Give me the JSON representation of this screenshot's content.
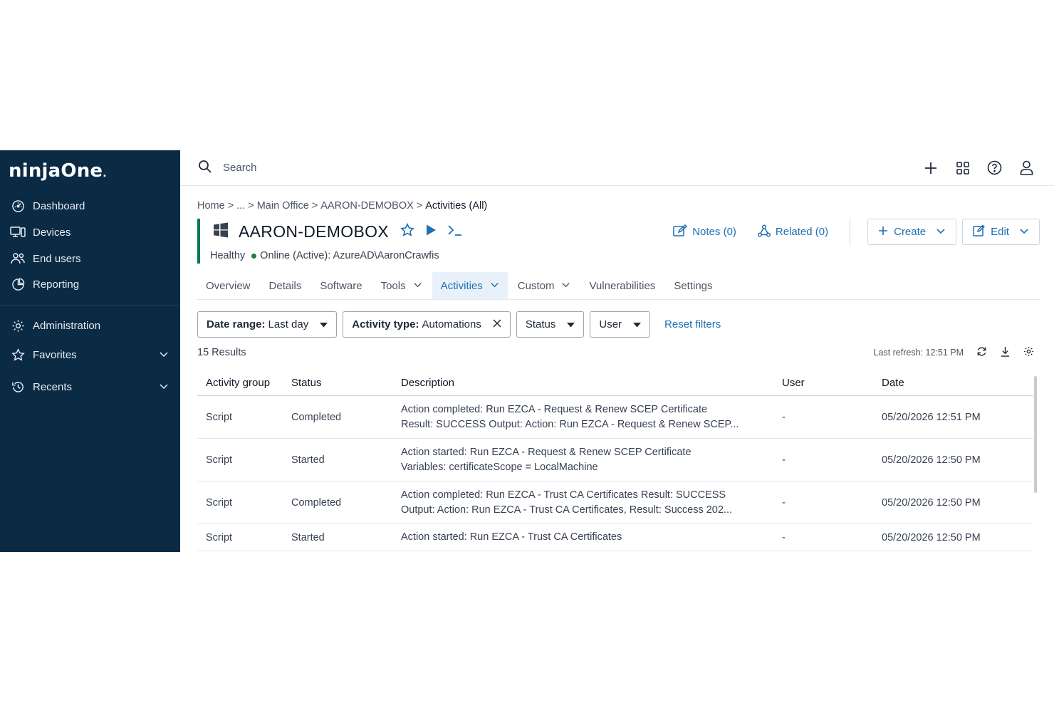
{
  "brand": {
    "logo_text": "ninjaOne"
  },
  "sidebar": {
    "items": [
      {
        "label": "Dashboard",
        "icon": "dashboard-icon"
      },
      {
        "label": "Devices",
        "icon": "devices-icon"
      },
      {
        "label": "End users",
        "icon": "end-users-icon"
      },
      {
        "label": "Reporting",
        "icon": "reporting-icon"
      },
      {
        "label": "Administration",
        "icon": "gear-icon"
      },
      {
        "label": "Favorites",
        "icon": "star-icon"
      },
      {
        "label": "Recents",
        "icon": "history-icon"
      }
    ]
  },
  "search": {
    "placeholder": "Search"
  },
  "breadcrumb": {
    "home": "Home",
    "ellipsis": "...",
    "office": "Main Office",
    "device": "AARON-DEMOBOX",
    "current": "Activities (All)"
  },
  "device": {
    "name": "AARON-DEMOBOX",
    "health": "Healthy",
    "status": "Online (Active): AzureAD\\AaronCrawfis"
  },
  "actions": {
    "notes": "Notes (0)",
    "related": "Related (0)",
    "create": "Create",
    "edit": "Edit"
  },
  "tabs": [
    {
      "label": "Overview"
    },
    {
      "label": "Details"
    },
    {
      "label": "Software"
    },
    {
      "label": "Tools"
    },
    {
      "label": "Activities"
    },
    {
      "label": "Custom"
    },
    {
      "label": "Vulnerabilities"
    },
    {
      "label": "Settings"
    }
  ],
  "filters": {
    "date_label": "Date range:",
    "date_value": "Last day",
    "activity_label": "Activity type:",
    "activity_value": "Automations",
    "status": "Status",
    "user": "User",
    "reset": "Reset filters"
  },
  "results": {
    "count": "15 Results",
    "last_refresh": "Last refresh: 12:51 PM"
  },
  "table": {
    "headers": {
      "group": "Activity group",
      "status": "Status",
      "description": "Description",
      "user": "User",
      "date": "Date"
    },
    "rows": [
      {
        "group": "Script",
        "status": "Completed",
        "desc1": "Action completed: Run EZCA - Request & Renew SCEP Certificate",
        "desc2": "Result: SUCCESS Output: Action: Run EZCA - Request & Renew SCEP...",
        "user": "-",
        "date": "05/20/2026 12:51 PM"
      },
      {
        "group": "Script",
        "status": "Started",
        "desc1": "Action started: Run EZCA - Request & Renew SCEP Certificate",
        "desc2": "Variables: certificateScope = LocalMachine",
        "user": "-",
        "date": "05/20/2026 12:50 PM"
      },
      {
        "group": "Script",
        "status": "Completed",
        "desc1": "Action completed: Run EZCA - Trust CA Certificates Result: SUCCESS",
        "desc2": "Output: Action: Run EZCA - Trust CA Certificates, Result: Success 202...",
        "user": "-",
        "date": "05/20/2026 12:50 PM"
      },
      {
        "group": "Script",
        "status": "Started",
        "desc1": "Action started: Run EZCA - Trust CA Certificates",
        "desc2": "",
        "user": "-",
        "date": "05/20/2026 12:50 PM"
      }
    ]
  },
  "colors": {
    "sidebar": "#0b2b45",
    "accent": "#1f6fb2",
    "healthy": "#047857",
    "active_tab_bg": "#e8f1fa"
  }
}
